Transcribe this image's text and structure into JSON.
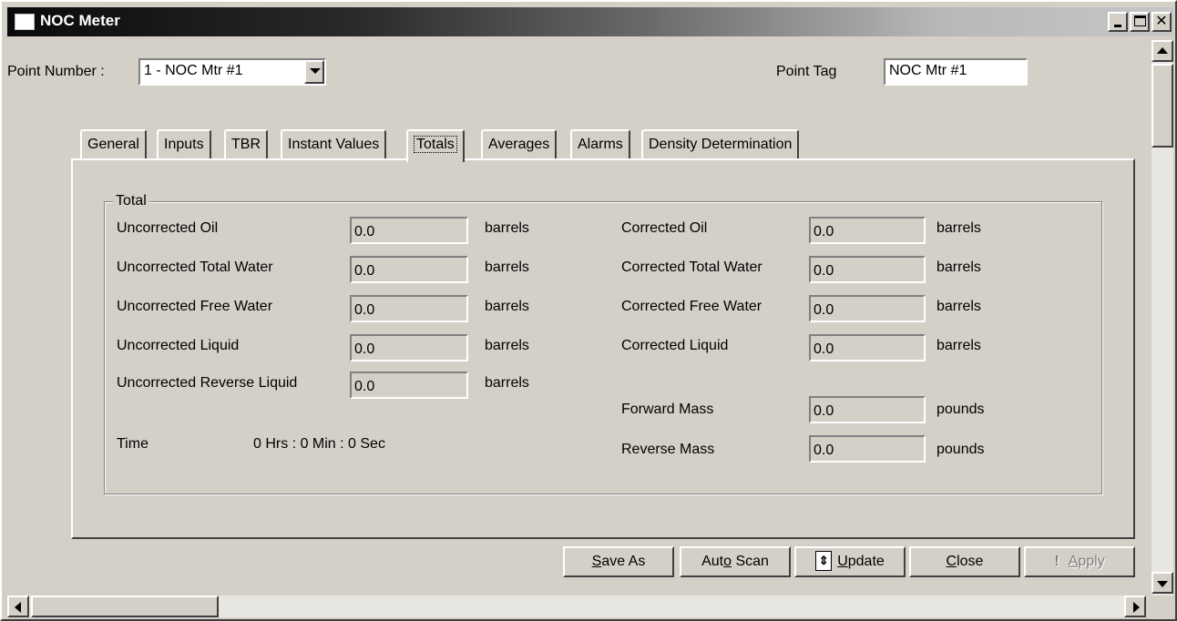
{
  "window": {
    "title": "NOC Meter",
    "min_glyph": "",
    "close_glyph": "✕"
  },
  "header": {
    "point_number_label": "Point Number :",
    "point_number_value": "1 - NOC Mtr #1",
    "point_tag_label": "Point Tag",
    "point_tag_value": "NOC Mtr #1"
  },
  "tabs": [
    {
      "label": "General"
    },
    {
      "label": "Inputs"
    },
    {
      "label": "TBR"
    },
    {
      "label": "Instant Values"
    },
    {
      "label": "Totals"
    },
    {
      "label": "Averages"
    },
    {
      "label": "Alarms"
    },
    {
      "label": "Density Determination"
    }
  ],
  "total_group": {
    "title": "Total",
    "left_rows": [
      {
        "label": "Uncorrected Oil",
        "value": "0.0",
        "unit": "barrels"
      },
      {
        "label": "Uncorrected Total Water",
        "value": "0.0",
        "unit": "barrels"
      },
      {
        "label": "Uncorrected Free Water",
        "value": "0.0",
        "unit": "barrels"
      },
      {
        "label": "Uncorrected Liquid",
        "value": "0.0",
        "unit": "barrels"
      },
      {
        "label": "Uncorrected Reverse Liquid",
        "value": "0.0",
        "unit": "barrels"
      }
    ],
    "right_rows": [
      {
        "label": "Corrected Oil",
        "value": "0.0",
        "unit": "barrels"
      },
      {
        "label": "Corrected Total Water",
        "value": "0.0",
        "unit": "barrels"
      },
      {
        "label": "Corrected Free Water",
        "value": "0.0",
        "unit": "barrels"
      },
      {
        "label": "Corrected Liquid",
        "value": "0.0",
        "unit": "barrels"
      },
      {
        "label": "Forward Mass",
        "value": "0.0",
        "unit": "pounds"
      },
      {
        "label": "Reverse Mass",
        "value": "0.0",
        "unit": "pounds"
      }
    ],
    "time_label": "Time",
    "time_value": "0 Hrs : 0 Min : 0 Sec"
  },
  "buttons": {
    "save_as_u": "S",
    "save_as_rest": "ave As",
    "auto_scan_a": "Aut",
    "auto_scan_u": "o",
    "auto_scan_b": " Scan",
    "update_icon": "⇕",
    "update_u": "U",
    "update_rest": "pdate",
    "close_u": "C",
    "close_rest": "lose",
    "apply_icon": "!",
    "apply_u": "A",
    "apply_rest": "pply"
  }
}
